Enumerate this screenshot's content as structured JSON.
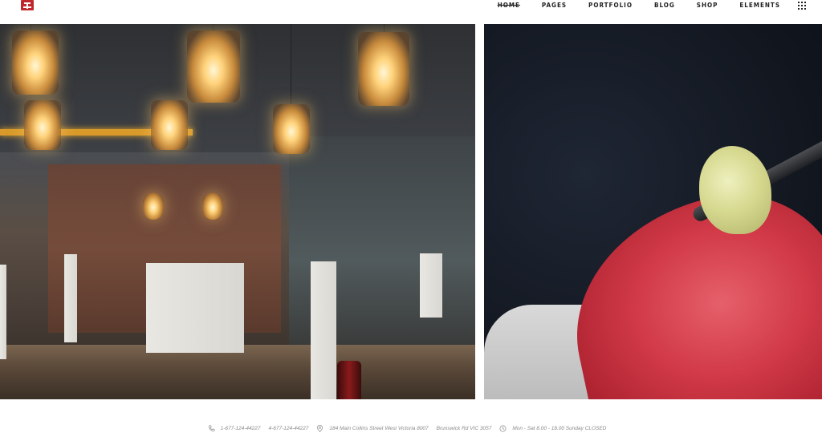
{
  "header": {
    "logo_icon": "restaurant-logo-icon",
    "nav": [
      {
        "label": "HOME",
        "active": true
      },
      {
        "label": "PAGES",
        "active": false
      },
      {
        "label": "PORTFOLIO",
        "active": false
      },
      {
        "label": "BLOG",
        "active": false
      },
      {
        "label": "SHOP",
        "active": false
      },
      {
        "label": "ELEMENTS",
        "active": false
      }
    ],
    "menu_icon": "grid-menu-icon"
  },
  "images": {
    "left_icon": "restaurant-interior-image",
    "right_icon": "tuna-sashimi-image"
  },
  "footer": {
    "phone1": "1-677-124-44227",
    "phone2": "4-677-124-44227",
    "address1": "184 Main Collins Street West Victoria 8007",
    "address2": "Brunswick Rd VIC 3057",
    "hours": "Mon - Sat 8.00 - 18.00 Sunday CLOSED"
  },
  "colors": {
    "brand": "#c0282d",
    "nav_text": "#222222",
    "footer_text": "#8a8a8a"
  }
}
